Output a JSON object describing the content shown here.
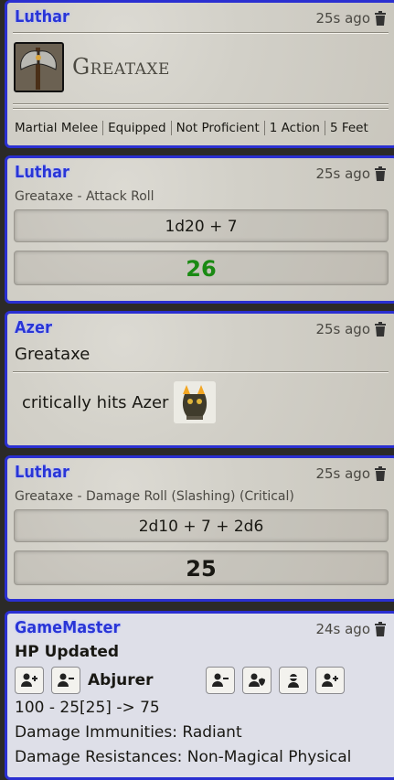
{
  "cards": [
    {
      "speaker": "Luthar",
      "time": "25s ago",
      "item_name": "Greataxe",
      "tags": [
        "Martial Melee",
        "Equipped",
        "Not Proficient",
        "1 Action",
        "5 Feet"
      ]
    },
    {
      "speaker": "Luthar",
      "time": "25s ago",
      "flavor": "Greataxe - Attack Roll",
      "formula": "1d20 + 7",
      "total": "26"
    },
    {
      "speaker": "Azer",
      "time": "25s ago",
      "subject": "Greataxe",
      "message": "critically hits Azer"
    },
    {
      "speaker": "Luthar",
      "time": "25s ago",
      "flavor": "Greataxe - Damage Roll (Slashing) (Critical)",
      "formula": "2d10 + 7 + 2d6",
      "total": "25"
    },
    {
      "speaker": "GameMaster",
      "time": "24s ago",
      "title": "HP Updated",
      "target": "Abjurer",
      "hp_change": "100 - 25[25] -> 75",
      "immunities": "Damage Immunities: Radiant",
      "resistances": "Damage Resistances: Non-Magical Physical"
    }
  ],
  "icons": {
    "trash": "trash-icon",
    "add_user": "user-plus-icon",
    "remove_user": "user-minus-icon",
    "shield_user": "user-shield-icon",
    "ninja": "user-ninja-icon"
  },
  "colors": {
    "speaker": "#2935d6",
    "card_border": "#2a2fd1",
    "success_total": "#1a8a13"
  }
}
